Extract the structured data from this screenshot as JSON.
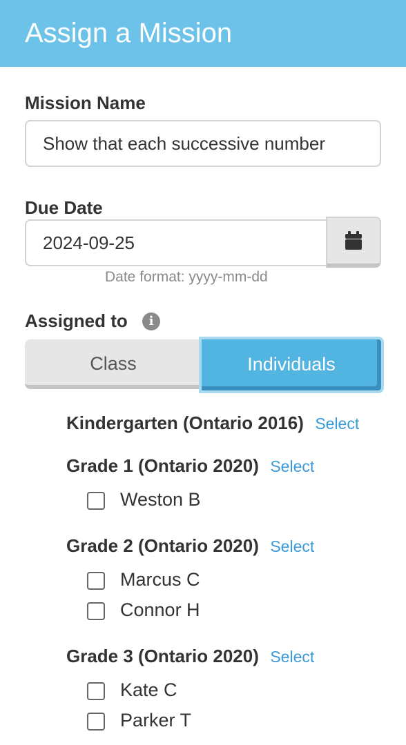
{
  "header": {
    "title": "Assign a Mission"
  },
  "mission_name": {
    "label": "Mission Name",
    "value": "Show that each successive number"
  },
  "due_date": {
    "label": "Due Date",
    "value": "2024-09-25",
    "hint": "Date format: yyyy-mm-dd",
    "button_icon": "calendar-icon"
  },
  "assigned_to": {
    "label": "Assigned to",
    "info_icon": "i",
    "options": {
      "class": "Class",
      "individuals": "Individuals"
    },
    "selected": "Individuals"
  },
  "groups": [
    {
      "name": "Kindergarten (Ontario 2016)",
      "select_label": "Select",
      "students": []
    },
    {
      "name": "Grade 1 (Ontario 2020)",
      "select_label": "Select",
      "students": [
        "Weston B"
      ]
    },
    {
      "name": "Grade 2 (Ontario 2020)",
      "select_label": "Select",
      "students": [
        "Marcus C",
        "Connor H"
      ]
    },
    {
      "name": "Grade 3 (Ontario 2020)",
      "select_label": "Select",
      "students": [
        "Kate C",
        "Parker T"
      ]
    }
  ],
  "colors": {
    "header": "#6cc2e8",
    "accent": "#52b4e1",
    "link": "#3a9ad9"
  }
}
